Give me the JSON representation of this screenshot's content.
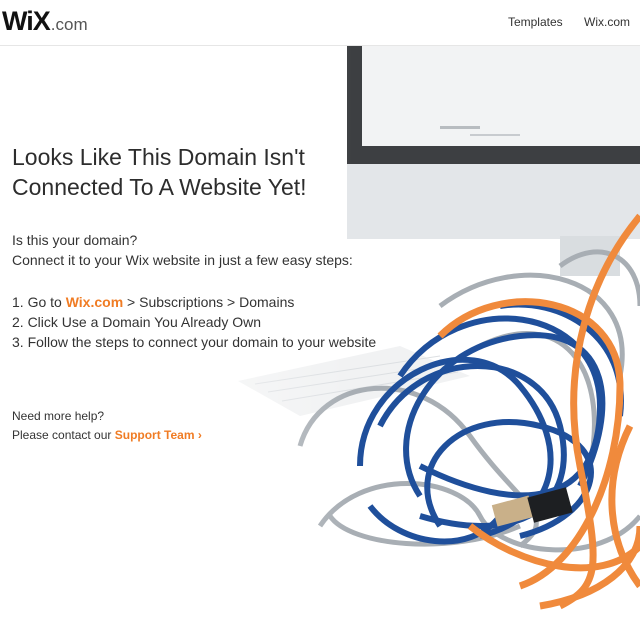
{
  "header": {
    "logo_main": "WiX",
    "logo_suffix": ".com",
    "nav": [
      "Templates",
      "Wix.com"
    ]
  },
  "main": {
    "headline_line1": "Looks Like This Domain Isn't",
    "headline_line2": "Connected To A Website Yet!",
    "question": "Is this your domain?",
    "intro": "Connect it to your Wix website in just a few easy steps:",
    "step1_prefix": "1. Go to ",
    "step1_link": "Wix.com",
    "step1_suffix": " > Subscriptions > Domains",
    "step2": "2. Click Use a Domain You Already Own",
    "step3": "3. Follow the steps to connect your domain to your website"
  },
  "help": {
    "question": "Need more help?",
    "prefix": "Please contact our ",
    "link": "Support Team",
    "chevron": "›"
  },
  "colors": {
    "accent": "#f07c24",
    "cable_blue": "#1f4f9b",
    "cable_orange": "#f08a3c",
    "cable_grey": "#a8aeb4"
  },
  "icons": [
    "chevron-right-icon"
  ]
}
